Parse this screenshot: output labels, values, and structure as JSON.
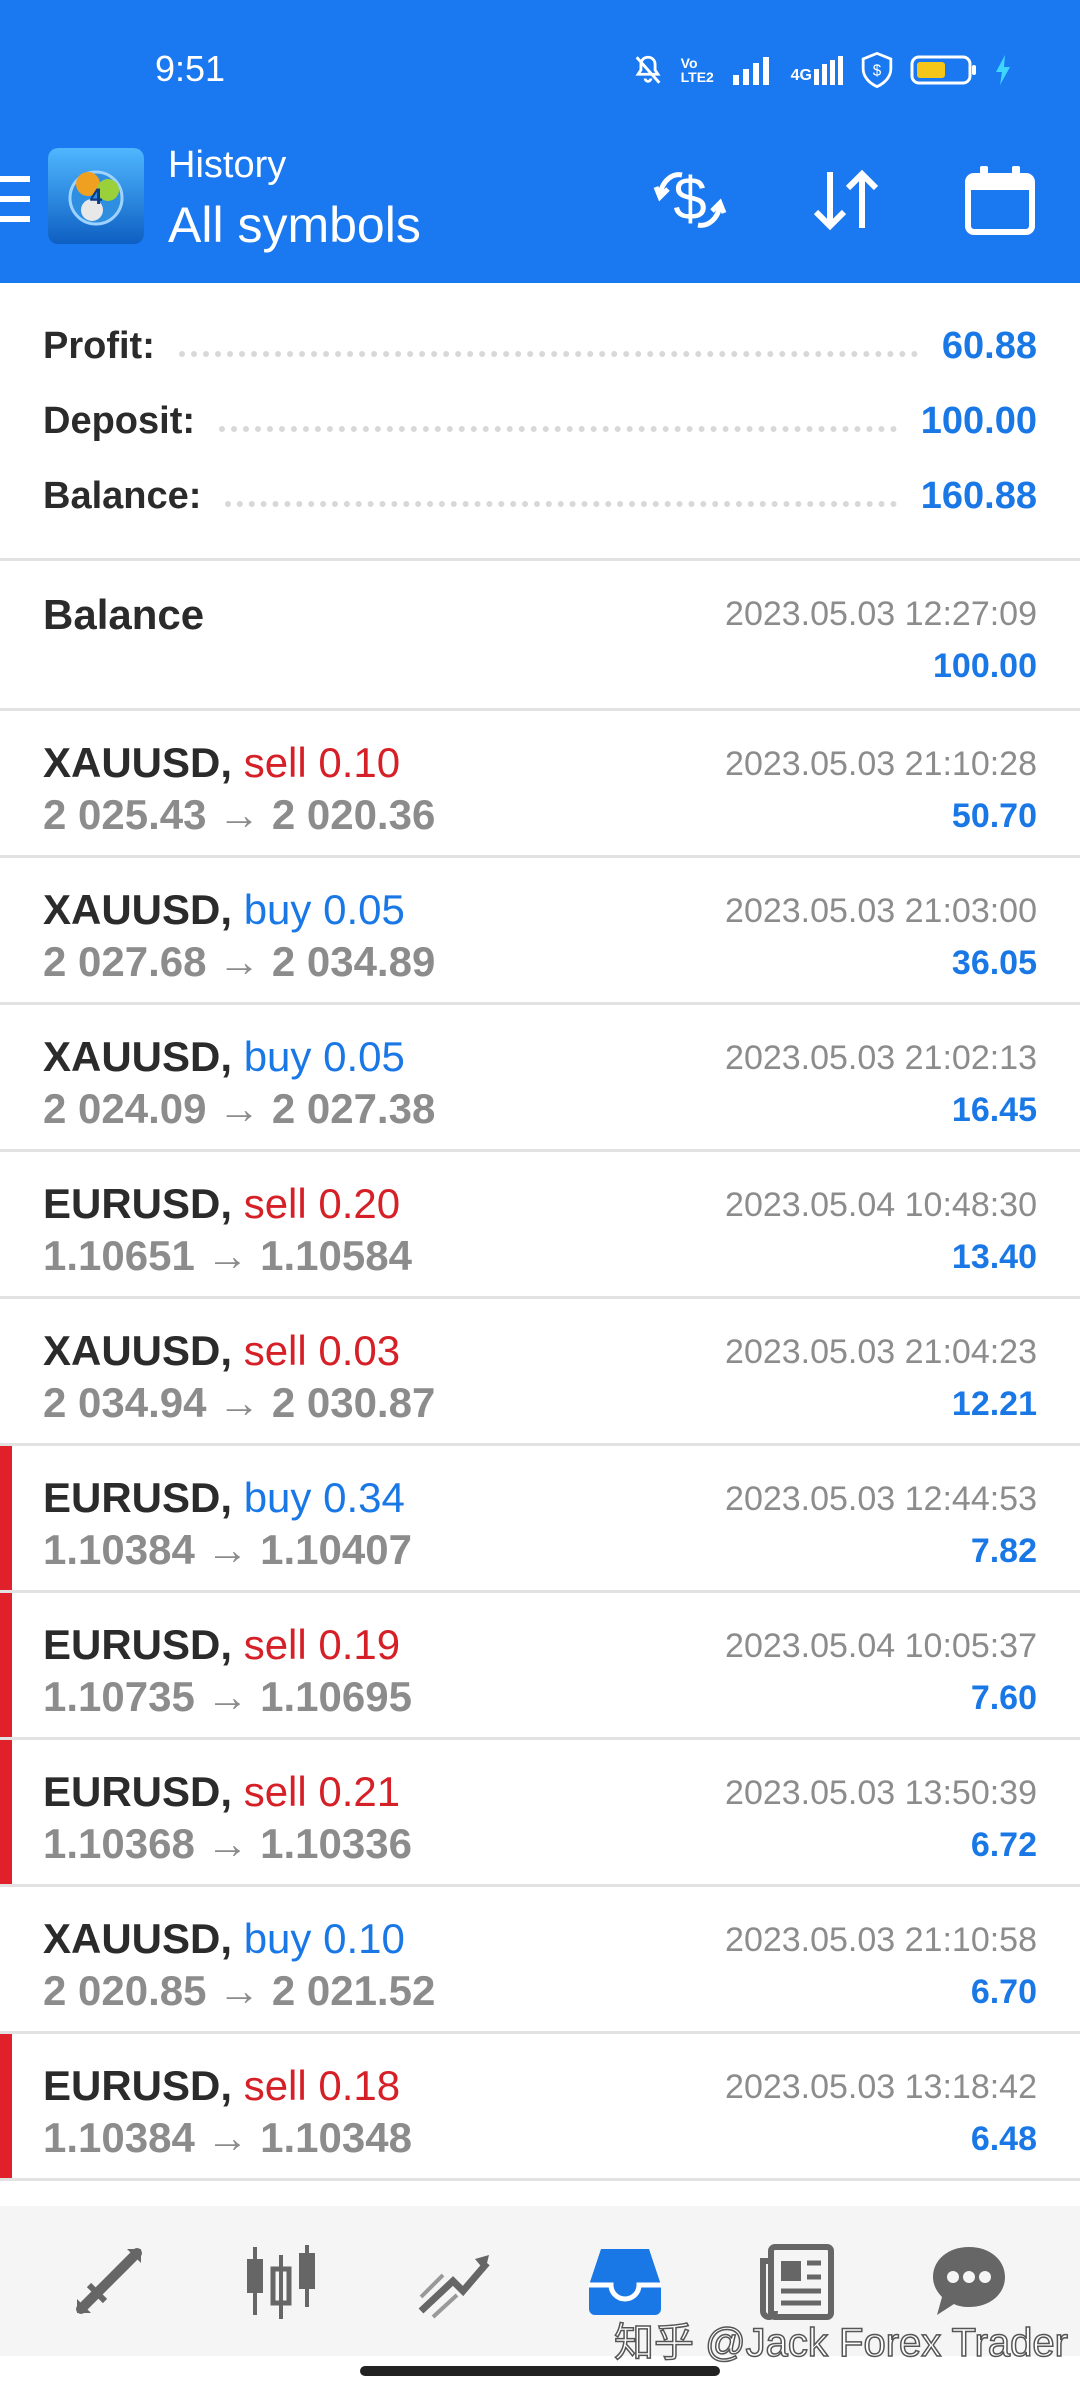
{
  "status_bar": {
    "time": "9:51",
    "network": "4G",
    "volte": "Vo LTE2"
  },
  "header": {
    "subtitle": "History",
    "title": "All symbols"
  },
  "summary": {
    "profit_label": "Profit:",
    "profit_value": "60.88",
    "deposit_label": "Deposit:",
    "deposit_value": "100.00",
    "balance_label": "Balance:",
    "balance_value": "160.88"
  },
  "balance_op": {
    "label": "Balance",
    "time": "2023.05.03 12:27:09",
    "amount": "100.00"
  },
  "deals": [
    {
      "symbol": "XAUUSD,",
      "side": "sell",
      "volume": "0.10",
      "prices": "2 025.43 → 2 020.36",
      "time": "2023.05.03 21:10:28",
      "profit": "50.70",
      "marker": false
    },
    {
      "symbol": "XAUUSD,",
      "side": "buy",
      "volume": "0.05",
      "prices": "2 027.68 → 2 034.89",
      "time": "2023.05.03 21:03:00",
      "profit": "36.05",
      "marker": false
    },
    {
      "symbol": "XAUUSD,",
      "side": "buy",
      "volume": "0.05",
      "prices": "2 024.09 → 2 027.38",
      "time": "2023.05.03 21:02:13",
      "profit": "16.45",
      "marker": false
    },
    {
      "symbol": "EURUSD,",
      "side": "sell",
      "volume": "0.20",
      "prices": "1.10651 → 1.10584",
      "time": "2023.05.04 10:48:30",
      "profit": "13.40",
      "marker": false
    },
    {
      "symbol": "XAUUSD,",
      "side": "sell",
      "volume": "0.03",
      "prices": "2 034.94 → 2 030.87",
      "time": "2023.05.03 21:04:23",
      "profit": "12.21",
      "marker": false
    },
    {
      "symbol": "EURUSD,",
      "side": "buy",
      "volume": "0.34",
      "prices": "1.10384 → 1.10407",
      "time": "2023.05.03 12:44:53",
      "profit": "7.82",
      "marker": true
    },
    {
      "symbol": "EURUSD,",
      "side": "sell",
      "volume": "0.19",
      "prices": "1.10735 → 1.10695",
      "time": "2023.05.04 10:05:37",
      "profit": "7.60",
      "marker": true
    },
    {
      "symbol": "EURUSD,",
      "side": "sell",
      "volume": "0.21",
      "prices": "1.10368 → 1.10336",
      "time": "2023.05.03 13:50:39",
      "profit": "6.72",
      "marker": true
    },
    {
      "symbol": "XAUUSD,",
      "side": "buy",
      "volume": "0.10",
      "prices": "2 020.85 → 2 021.52",
      "time": "2023.05.03 21:10:58",
      "profit": "6.70",
      "marker": false
    },
    {
      "symbol": "EURUSD,",
      "side": "sell",
      "volume": "0.18",
      "prices": "1.10384 → 1.10348",
      "time": "2023.05.03 13:18:42",
      "profit": "6.48",
      "marker": true
    }
  ],
  "bottom_nav": {
    "items": [
      "quotes-icon",
      "chart-icon",
      "trade-icon",
      "history-icon",
      "news-icon",
      "chat-icon"
    ],
    "active": "history-icon"
  },
  "watermark": "知乎 @Jack Forex Trader",
  "colors": {
    "brand_blue": "#1a78f0",
    "sell_red": "#d62027",
    "buy_blue": "#1a78e6",
    "marker_red": "#e0202a"
  }
}
